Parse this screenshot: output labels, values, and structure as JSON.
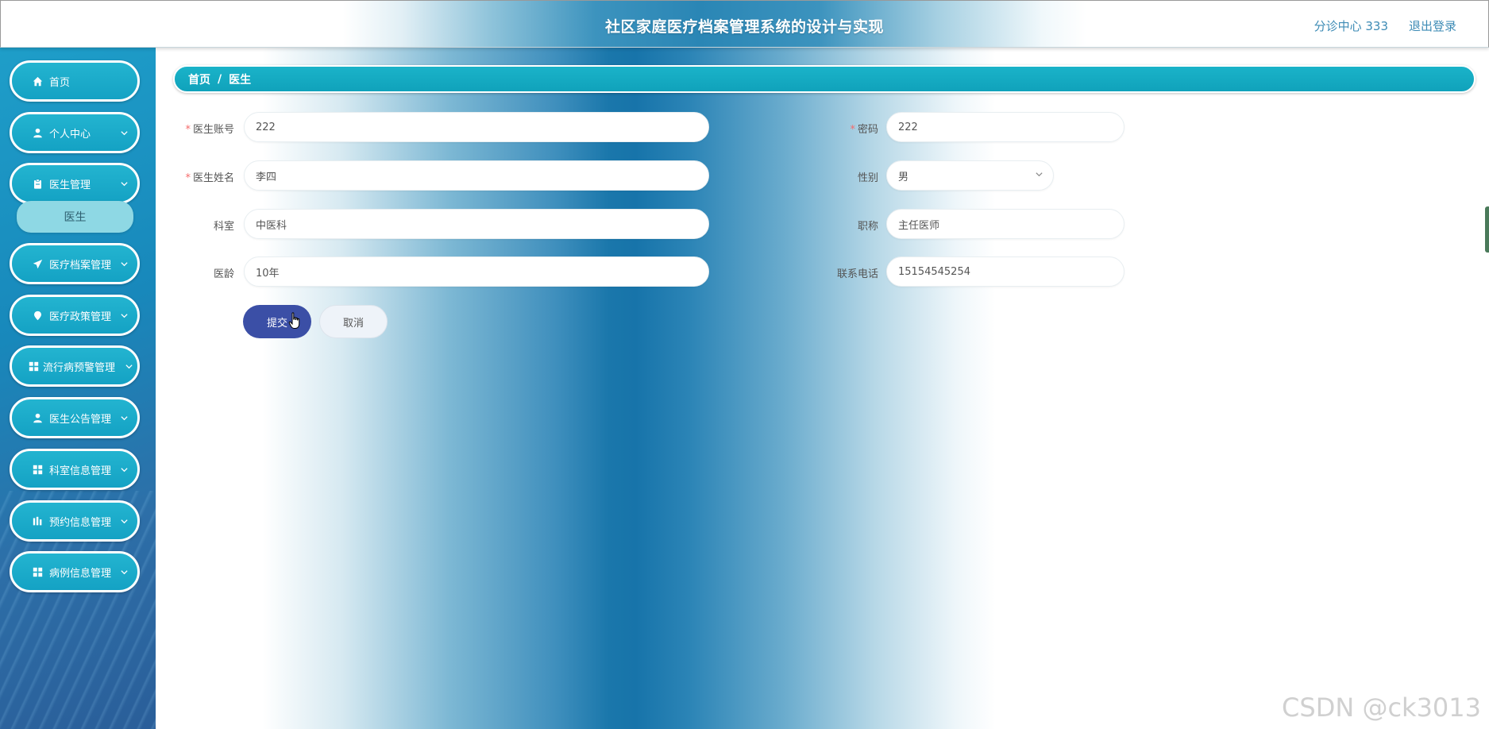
{
  "header": {
    "title": "社区家庭医疗档案管理系统的设计与实现",
    "user": "分诊中心 333",
    "logout": "退出登录"
  },
  "sidebar": {
    "items": [
      {
        "label": "首页",
        "icon": "home-icon"
      },
      {
        "label": "个人中心",
        "icon": "user-icon"
      },
      {
        "label": "医生管理",
        "icon": "clipboard-icon"
      },
      {
        "label": "医疗档案管理",
        "icon": "send-icon"
      },
      {
        "label": "医疗政策管理",
        "icon": "location-pin-icon"
      },
      {
        "label": "流行病预警管理",
        "icon": "grid-icon"
      },
      {
        "label": "医生公告管理",
        "icon": "user-icon"
      },
      {
        "label": "科室信息管理",
        "icon": "grid-icon"
      },
      {
        "label": "预约信息管理",
        "icon": "chart-icon"
      },
      {
        "label": "病例信息管理",
        "icon": "grid-icon"
      }
    ],
    "sub_item": "医生"
  },
  "breadcrumb": {
    "home": "首页",
    "separator": "/",
    "current": "医生"
  },
  "form": {
    "account_label": "医生账号",
    "account_value": "222",
    "password_label": "密码",
    "password_value": "222",
    "name_label": "医生姓名",
    "name_value": "李四",
    "gender_label": "性别",
    "gender_value": "男",
    "dept_label": "科室",
    "dept_value": "中医科",
    "title_label": "职称",
    "title_value": "主任医师",
    "years_label": "医龄",
    "years_value": "10年",
    "phone_label": "联系电话",
    "phone_value": "15154545254",
    "required_mark": "*",
    "submit": "提交",
    "cancel": "取消"
  },
  "watermark": "CSDN @ck3013",
  "colors": {
    "accent": "#14a2c4",
    "submit": "#3b4fa6",
    "required": "#f56c6c"
  }
}
